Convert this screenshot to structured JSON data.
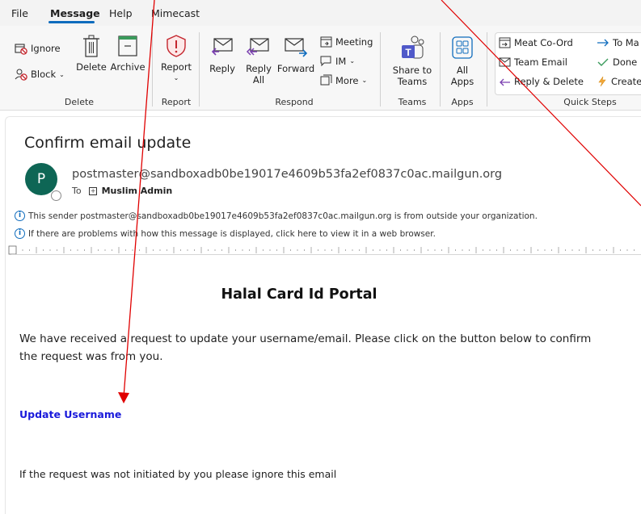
{
  "menu": {
    "items": [
      "File",
      "Message",
      "Help",
      "Mimecast"
    ],
    "active": "Message"
  },
  "ribbon": {
    "delete_group": {
      "ignore": "Ignore",
      "block": "Block",
      "delete": "Delete",
      "archive": "Archive",
      "label": "Delete"
    },
    "report_group": {
      "report": "Report",
      "label": "Report"
    },
    "respond_group": {
      "reply": "Reply",
      "reply_all_line1": "Reply",
      "reply_all_line2": "All",
      "forward": "Forward",
      "meeting": "Meeting",
      "im": "IM",
      "more": "More",
      "label": "Respond"
    },
    "teams_group": {
      "share_line1": "Share to",
      "share_line2": "Teams",
      "label": "Teams"
    },
    "apps_group": {
      "all_line1": "All",
      "all_line2": "Apps",
      "label": "Apps"
    },
    "quick_steps": {
      "items": [
        "Meat Co-Ord",
        "Team Email",
        "Reply & Delete",
        "To Ma",
        "Done",
        "Create"
      ],
      "label": "Quick Steps"
    }
  },
  "message": {
    "subject": "Confirm email update",
    "avatar_initial": "P",
    "sender": "postmaster@sandboxadb0be19017e4609b53fa2ef0837c0ac.mailgun.org",
    "to_label": "To",
    "recipient": "Muslim Admin",
    "notice_outside": "This sender postmaster@sandboxadb0be19017e4609b53fa2ef0837c0ac.mailgun.org is from outside your organization.",
    "notice_display": "If there are problems with how this message is displayed, click here to view it in a web browser."
  },
  "body": {
    "portal_title": "Halal Card Id Portal",
    "paragraph": "We have received a request to update your username/email. Please click on the button below to confirm the request was from you.",
    "link": "Update Username",
    "ignore_text": "If the request was not initiated by you please ignore this email"
  },
  "colors": {
    "accent": "#0f6cbd",
    "avatar": "#0e6655",
    "link": "#1a1adb",
    "annotation_arrow": "#e00000"
  }
}
